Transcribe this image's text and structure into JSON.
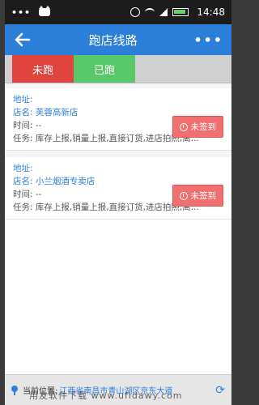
{
  "status_bar": {
    "time": "14:48"
  },
  "header": {
    "title": "跑店线路",
    "more": "•••"
  },
  "tabs": [
    {
      "label": "未跑"
    },
    {
      "label": "已跑"
    }
  ],
  "stores": [
    {
      "address_label": "地址:",
      "store_name_label": "店名:",
      "store_name": "芙蓉高新店",
      "time_label": "时间:",
      "time_value": "--",
      "task_label": "任务:",
      "task_value": "库存上报,销量上报,直接订货,进店拍照,离...",
      "status": "未签到"
    },
    {
      "address_label": "地址:",
      "store_name_label": "店名:",
      "store_name": "小兰烟酒专卖店",
      "time_label": "时间:",
      "time_value": "--",
      "task_label": "任务:",
      "task_value": "库存上报,销量上报,直接订货,进店拍照,离...",
      "status": "未签到"
    }
  ],
  "bottom": {
    "location_label": "当前位置:",
    "location_value": "江西省南昌市青山湖区京东大道",
    "watermark": "用友软件下载 www.ufidawy.com"
  },
  "colors": {
    "header": "#2b7fd8",
    "tab_unrun": "#e0443e",
    "tab_run": "#59c86a",
    "sign_button": "#f07070"
  }
}
